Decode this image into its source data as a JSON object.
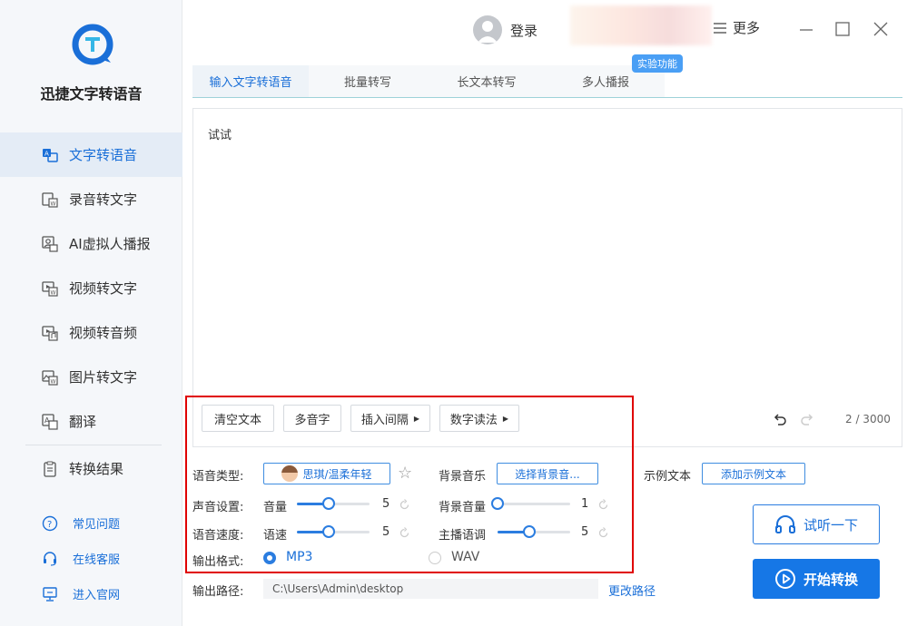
{
  "app": {
    "title": "迅捷文字转语音",
    "accent_color": "#1a6fd8"
  },
  "sidebar": {
    "items": [
      {
        "label": "文字转语音",
        "icon": "text-translate-icon",
        "active": true
      },
      {
        "label": "录音转文字",
        "icon": "audio-to-word-icon"
      },
      {
        "label": "AI虚拟人播报",
        "icon": "virtual-person-icon"
      },
      {
        "label": "视频转文字",
        "icon": "video-to-word-icon"
      },
      {
        "label": "视频转音频",
        "icon": "video-to-audio-icon"
      },
      {
        "label": "图片转文字",
        "icon": "image-to-word-icon"
      },
      {
        "label": "翻译",
        "icon": "translate-icon"
      }
    ],
    "result": {
      "label": "转换结果",
      "icon": "clipboard-icon"
    },
    "bottom": [
      {
        "label": "常见问题",
        "icon": "question-icon"
      },
      {
        "label": "在线客服",
        "icon": "headset-icon"
      },
      {
        "label": "进入官网",
        "icon": "monitor-icon"
      }
    ]
  },
  "header": {
    "login": "登录",
    "more": "更多"
  },
  "tabs": [
    {
      "label": "输入文字转语音",
      "active": true
    },
    {
      "label": "批量转写"
    },
    {
      "label": "长文本转写"
    },
    {
      "label": "多人播报",
      "badge": "实验功能"
    }
  ],
  "editor": {
    "text": "试试",
    "buttons": {
      "clear": "清空文本",
      "polyphone": "多音字",
      "insert_pause": "插入间隔",
      "number_reading": "数字读法"
    },
    "counter": "2 / 3000"
  },
  "settings": {
    "voice_type_label": "语音类型:",
    "voice_name": "思琪/温柔年轻",
    "bgm_label": "背景音乐",
    "bgm_button": "选择背景音...",
    "sample_label": "示例文本",
    "sample_button": "添加示例文本",
    "sound_label": "声音设置:",
    "volume_label": "音量",
    "volume_value": 5,
    "bg_volume_label": "背景音量",
    "bg_volume_value": 1,
    "speed_label": "语音速度:",
    "rate_label": "语速",
    "rate_value": 5,
    "pitch_label": "主播语调",
    "pitch_value": 5,
    "format_label": "输出格式:",
    "format_options": [
      "MP3",
      "WAV"
    ],
    "format_selected": "MP3",
    "path_label": "输出路径:",
    "path_value": "C:\\Users\\Admin\\desktop",
    "change_path": "更改路径"
  },
  "actions": {
    "listen": "试听一下",
    "start": "开始转换"
  }
}
